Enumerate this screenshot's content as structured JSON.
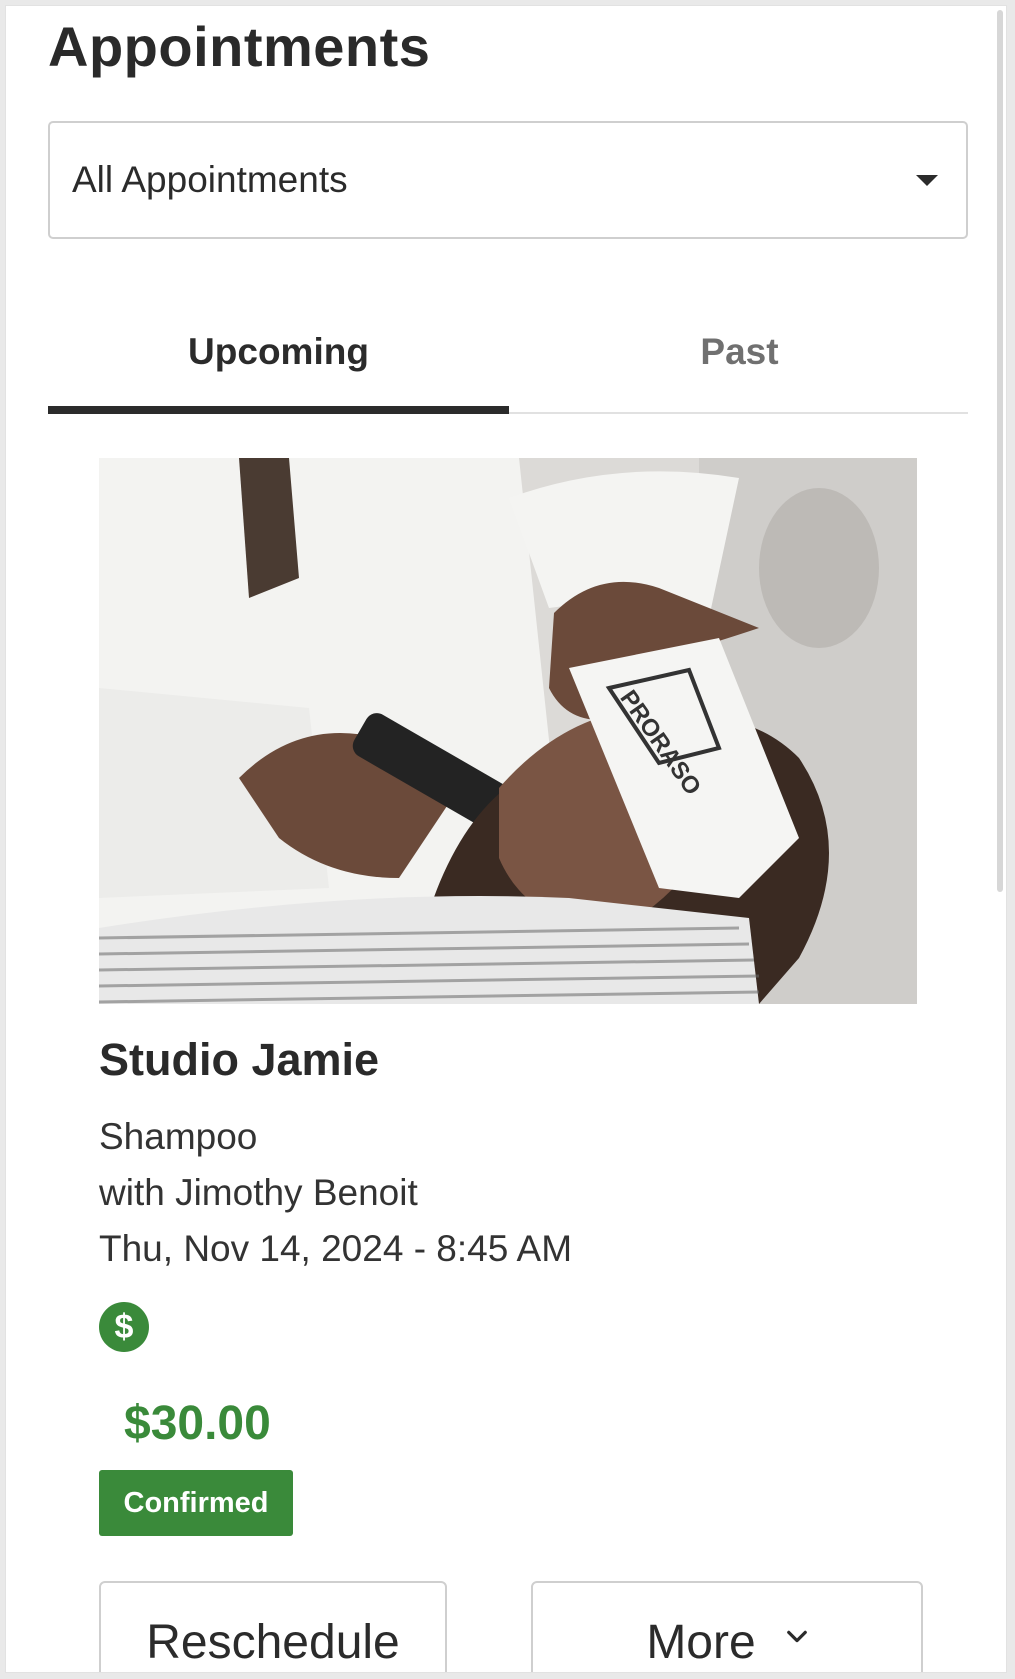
{
  "header": {
    "title": "Appointments"
  },
  "filter": {
    "selected": "All Appointments",
    "icon": "caret-down-icon"
  },
  "tabs": [
    {
      "label": "Upcoming",
      "active": true
    },
    {
      "label": "Past",
      "active": false
    }
  ],
  "appointment": {
    "studio": "Studio Jamie",
    "service": "Shampoo",
    "staff": "with Jimothy Benoit",
    "datetime": "Thu, Nov 14, 2024 - 8:45 AM",
    "payment_icon": "dollar-icon",
    "payment_glyph": "$",
    "price": "$30.00",
    "status": "Confirmed",
    "photo_brand": "PRORASO"
  },
  "actions": {
    "reschedule_label": "Reschedule",
    "more_label": "More",
    "more_icon": "chevron-down-icon"
  },
  "colors": {
    "accent_green": "#3a8a3a",
    "text_dark": "#2b2b2b",
    "tab_inactive": "#707070",
    "border": "#cfcfcf"
  }
}
